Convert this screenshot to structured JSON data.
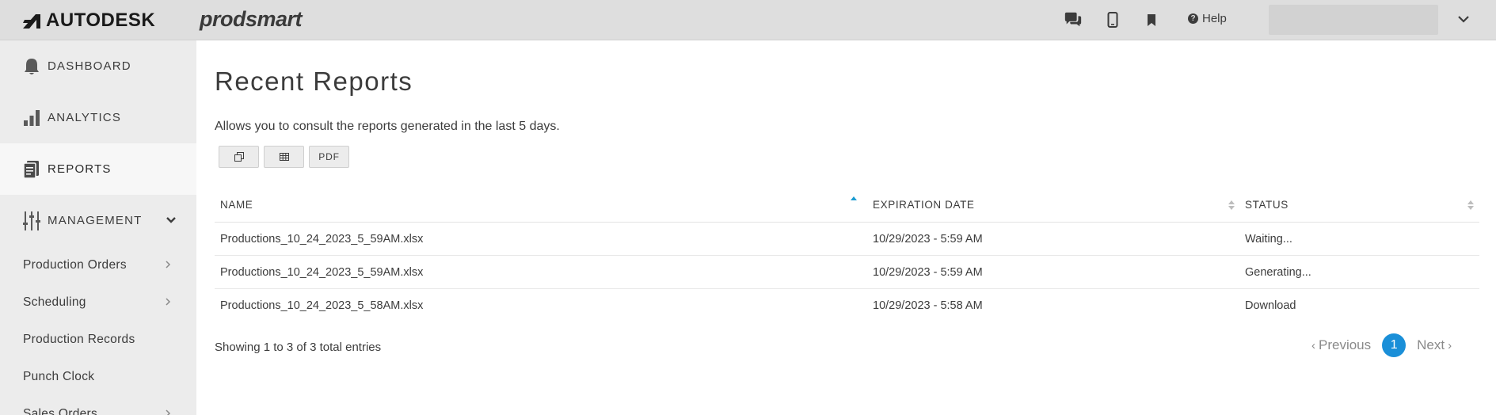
{
  "header": {
    "brand": "AUTODESK",
    "product": "prodsmart",
    "help_label": "Help",
    "icons": [
      "chat-icon",
      "mobile-icon",
      "bookmark-icon",
      "help-icon",
      "chevron-down-icon"
    ]
  },
  "sidebar": {
    "items": [
      {
        "label": "DASHBOARD",
        "icon": "bell-icon"
      },
      {
        "label": "ANALYTICS",
        "icon": "bar-chart-icon"
      },
      {
        "label": "REPORTS",
        "icon": "document-icon",
        "active": true
      },
      {
        "label": "MANAGEMENT",
        "icon": "sliders-icon",
        "expanded": true
      }
    ],
    "subitems": [
      {
        "label": "Production Orders",
        "has_children": true
      },
      {
        "label": "Scheduling",
        "has_children": true
      },
      {
        "label": "Production Records",
        "has_children": false
      },
      {
        "label": "Punch Clock",
        "has_children": false
      },
      {
        "label": "Sales Orders",
        "has_children": true
      }
    ]
  },
  "main": {
    "title": "Recent Reports",
    "description": "Allows you to consult the reports generated in the last 5 days.",
    "export_buttons": [
      {
        "name": "copy-button",
        "icon": "copy-icon",
        "label": ""
      },
      {
        "name": "excel-button",
        "icon": "table-icon",
        "label": ""
      },
      {
        "name": "pdf-button",
        "icon": "",
        "label": "PDF"
      }
    ],
    "table": {
      "columns": [
        "NAME",
        "EXPIRATION DATE",
        "STATUS"
      ],
      "sorted_column": "NAME",
      "sort_direction": "asc",
      "rows": [
        {
          "name": "Productions_10_24_2023_5_59AM.xlsx",
          "expiration": "10/29/2023 - 5:59 AM",
          "status": "Waiting..."
        },
        {
          "name": "Productions_10_24_2023_5_59AM.xlsx",
          "expiration": "10/29/2023 - 5:59 AM",
          "status": "Generating..."
        },
        {
          "name": "Productions_10_24_2023_5_58AM.xlsx",
          "expiration": "10/29/2023 - 5:58 AM",
          "status": "Download"
        }
      ]
    },
    "info": "Showing 1 to 3 of 3 total entries",
    "pagination": {
      "previous": "Previous",
      "current": "1",
      "next": "Next"
    }
  },
  "colors": {
    "accent": "#1a8fd8",
    "sort_active": "#1a9bd1",
    "topbar": "#dedede",
    "sidebar": "#ececec"
  }
}
